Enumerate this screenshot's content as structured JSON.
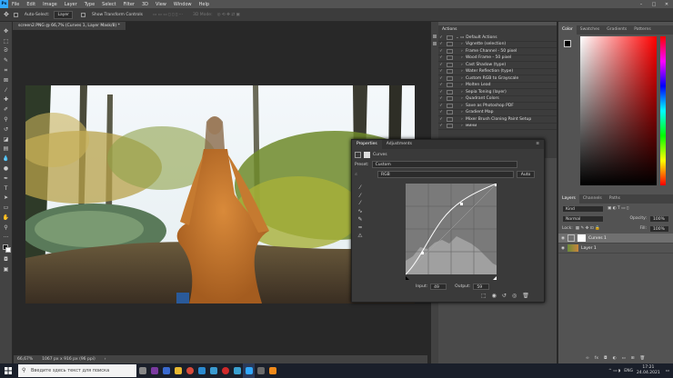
{
  "app": {
    "logo": "Ps",
    "menu": [
      "File",
      "Edit",
      "Image",
      "Layer",
      "Type",
      "Select",
      "Filter",
      "3D",
      "View",
      "Window",
      "Help"
    ]
  },
  "options": {
    "auto_select": "Auto-Select:",
    "layer_value": "Layer",
    "show_transform": "Show Transform Controls",
    "mode_3d": "3D Mode:"
  },
  "document": {
    "tab": "screen2.PNG @ 66,7% (Curves 1, Layer Mask/8) *",
    "zoom": "66,67%",
    "size": "1067 px x 916 px (96 ppi)"
  },
  "actions": {
    "tab": "Actions",
    "items": [
      {
        "label": "Default Actions",
        "set": true
      },
      {
        "label": "Vignette (selection)"
      },
      {
        "label": "Frame Channel - 50 pixel"
      },
      {
        "label": "Wood Frame - 50 pixel"
      },
      {
        "label": "Cast Shadow (type)"
      },
      {
        "label": "Water Reflection (type)"
      },
      {
        "label": "Custom RGB to Grayscale"
      },
      {
        "label": "Molten Lead"
      },
      {
        "label": "Sepia Toning (layer)"
      },
      {
        "label": "Quadrant Colors"
      },
      {
        "label": "Save as Photoshop PDF"
      },
      {
        "label": "Gradient Map"
      },
      {
        "label": "Mixer Brush Cloning Paint Setup"
      },
      {
        "label": "мини"
      }
    ]
  },
  "properties": {
    "tab_properties": "Properties",
    "tab_adjustments": "Adjustments",
    "title": "Curves",
    "preset_label": "Preset:",
    "preset_value": "Custom",
    "channel": "RGB",
    "auto": "Auto",
    "input_label": "Input:",
    "input_value": "49",
    "output_label": "Output:",
    "output_value": "59"
  },
  "color_panel": {
    "tabs": [
      "Color",
      "Swatches",
      "Gradients",
      "Patterns"
    ]
  },
  "layers_panel": {
    "tabs": [
      "Layers",
      "Channels",
      "Paths"
    ],
    "kind": "Kind",
    "blend": "Normal",
    "opacity_label": "Opacity:",
    "opacity_value": "100%",
    "lock_label": "Lock:",
    "fill_label": "Fill:",
    "fill_value": "100%",
    "layers": [
      {
        "name": "Curves 1",
        "selected": true
      },
      {
        "name": "Layer 1",
        "selected": false
      }
    ]
  },
  "taskbar": {
    "search": "Введите здесь текст для поиска",
    "lang": "ENG",
    "time": "17:21",
    "date": "24.04.2021"
  },
  "colors": {
    "accent": "#31a8ff",
    "ui_dark": "#282828",
    "panel": "#535353"
  }
}
